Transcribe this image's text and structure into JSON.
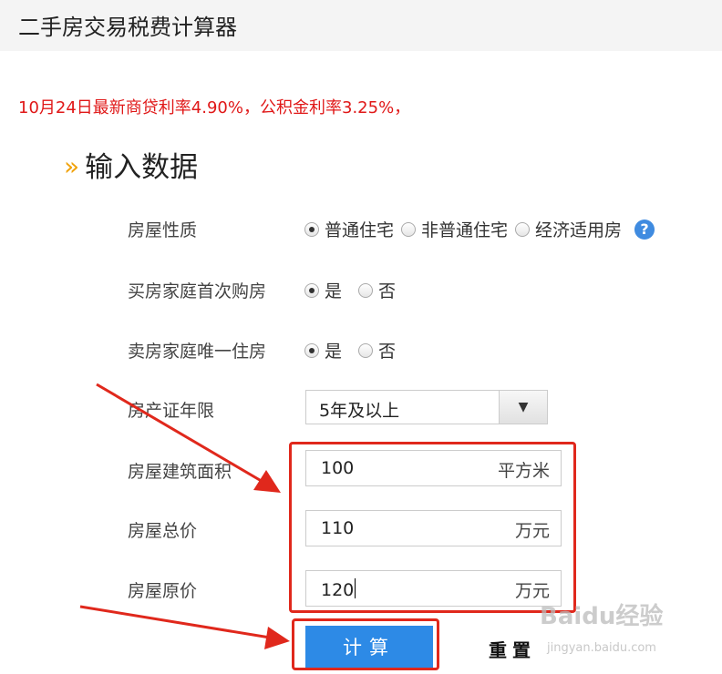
{
  "header": {
    "title": "二手房交易税费计算器"
  },
  "notice": "10月24日最新商贷利率4.90%，公积金利率3.25%，",
  "section": {
    "chevron": "»",
    "title": "输入数据"
  },
  "house_type": {
    "label": "房屋性质",
    "options": [
      "普通住宅",
      "非普通住宅",
      "经济适用房"
    ],
    "selected": "普通住宅",
    "help_icon": "?"
  },
  "first_purchase": {
    "label": "买房家庭首次购房",
    "options": [
      "是",
      "否"
    ],
    "selected": "是"
  },
  "seller_only_home": {
    "label": "卖房家庭唯一住房",
    "options": [
      "是",
      "否"
    ],
    "selected": "是"
  },
  "cert_years": {
    "label": "房产证年限",
    "value": "5年及以上",
    "dropdown_icon": "▼"
  },
  "area": {
    "label": "房屋建筑面积",
    "value": "100",
    "unit": "平方米"
  },
  "total_price": {
    "label": "房屋总价",
    "value": "110",
    "unit": "万元"
  },
  "original_price": {
    "label": "房屋原价",
    "value": "120",
    "unit": "万元"
  },
  "buttons": {
    "calculate": "计算",
    "reset": "重置"
  },
  "watermark": {
    "brand": "Baidu经验",
    "url": "jingyan.baidu.com"
  },
  "colors": {
    "accent": "#2d8ae6",
    "highlight": "#e0281c",
    "notice": "#e01818",
    "chevron": "#f0a20a"
  }
}
